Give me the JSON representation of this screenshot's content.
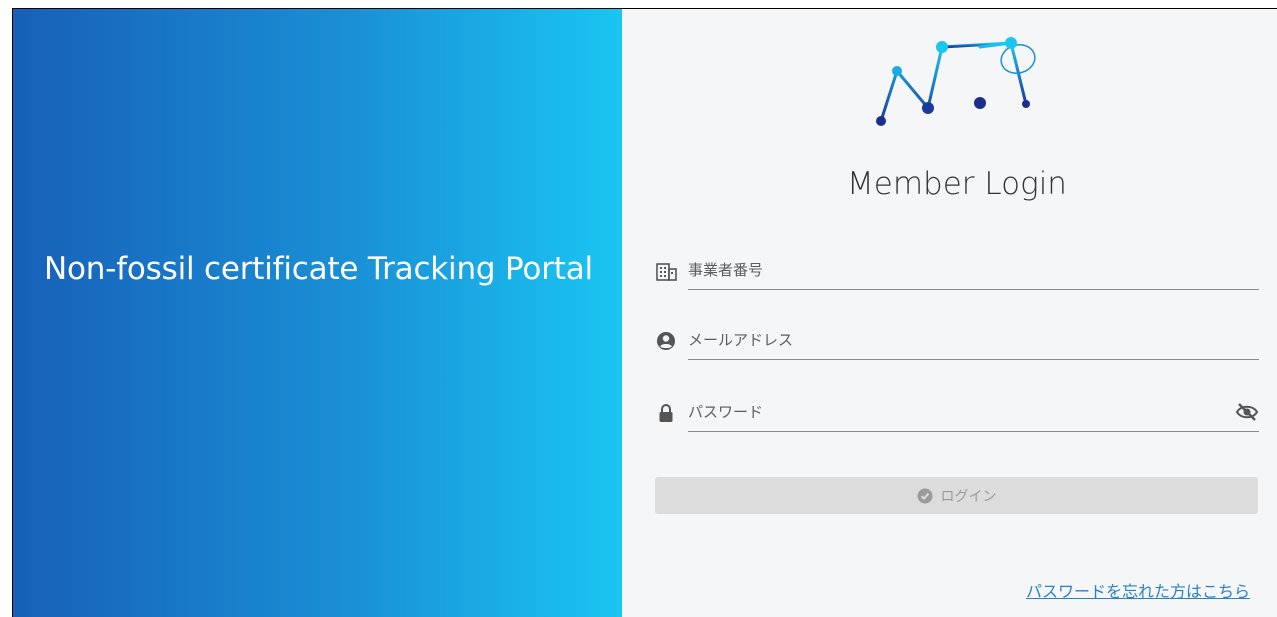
{
  "hero": {
    "title": "Non-fossil certificate Tracking Portal"
  },
  "login": {
    "heading": "Member Login",
    "fields": {
      "company_number": {
        "placeholder": "事業者番号",
        "icon": "building-icon"
      },
      "email": {
        "placeholder": "メールアドレス",
        "icon": "user-icon"
      },
      "password": {
        "placeholder": "パスワード",
        "icon": "lock-icon",
        "toggle_icon": "eye-slash-icon"
      }
    },
    "button": {
      "label": "ログイン",
      "icon": "check-circle-icon"
    },
    "forgot_password": "パスワードを忘れた方はこちら"
  },
  "colors": {
    "left_gradient_start": "#1760b8",
    "left_gradient_end": "#1ac6f2",
    "right_background": "#f4f6f8",
    "link": "#2a82c6",
    "button_disabled": "#dcdcdc"
  }
}
